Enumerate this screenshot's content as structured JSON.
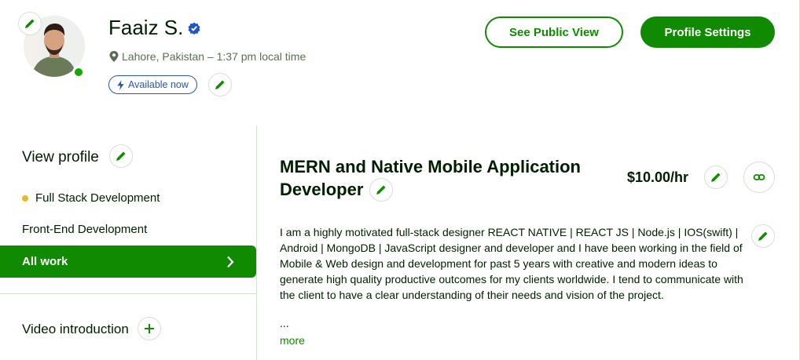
{
  "profile": {
    "name": "Faaiz S.",
    "location": "Lahore, Pakistan – 1:37 pm local time",
    "availability": "Available now"
  },
  "header_buttons": {
    "public_view": "See Public View",
    "settings": "Profile Settings"
  },
  "sidebar": {
    "view_profile": "View profile",
    "items": [
      {
        "label": "Full Stack Development",
        "selected": true
      },
      {
        "label": "Front-End Development"
      },
      {
        "label": "All work",
        "active": true
      }
    ],
    "video_intro": "Video introduction"
  },
  "main": {
    "title": "MERN and Native Mobile Application Developer",
    "rate": "$10.00/hr",
    "description": "I am a highly motivated full-stack designer REACT NATIVE | REACT JS | Node.js | IOS(swift) | Android | MongoDB | JavaScript designer and developer and I have been working in the field of Mobile & Web design and development for past 5 years with creative and modern ideas to generate high quality productive outcomes for my clients worldwide. I tend to communicate with the client to have a clear understanding of their needs and vision of the project.",
    "ellipsis": "...",
    "more": "more"
  },
  "colors": {
    "brand_green": "#108a00",
    "verified_blue": "#1f57c3",
    "bullet_yellow": "#e8b92a"
  },
  "icons": [
    "pencil-icon",
    "verified-badge-icon",
    "location-pin-icon",
    "lightning-icon",
    "chevron-right-icon",
    "plus-icon",
    "link-icon"
  ]
}
